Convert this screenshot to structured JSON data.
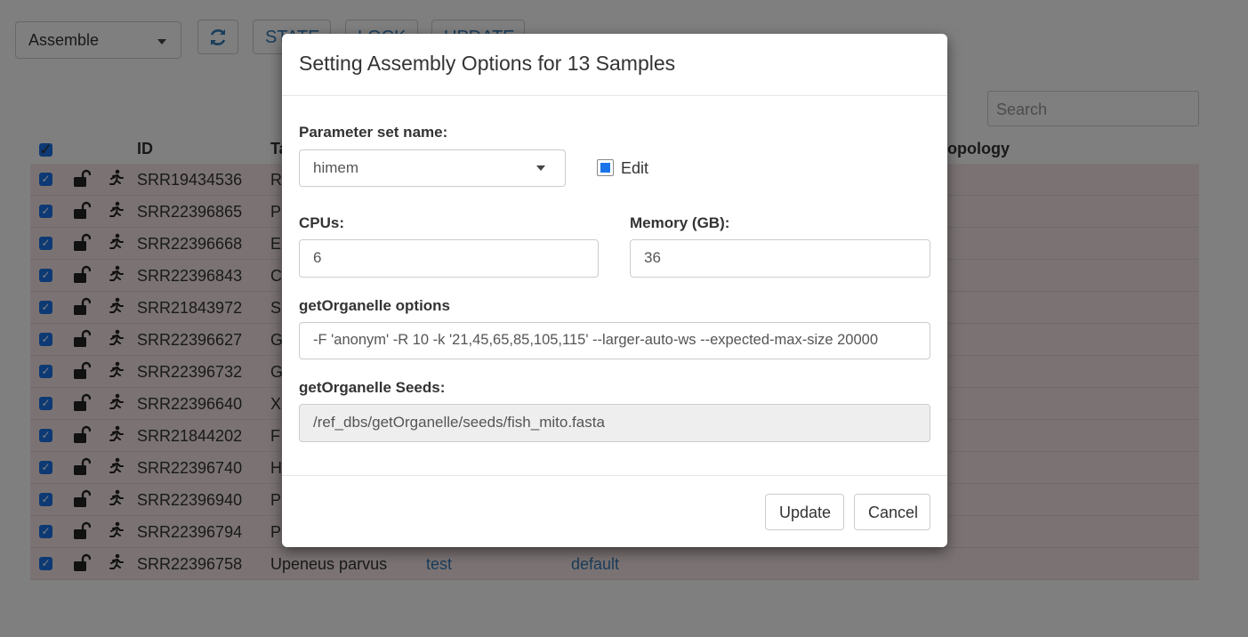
{
  "toolbar": {
    "mode_select": "Assemble",
    "refresh_icon": "refresh-icon",
    "state_label": "STATE",
    "lock_label": "LOCK",
    "update_label": "UPDATE",
    "search_placeholder": "Search"
  },
  "table": {
    "headers": {
      "id": "ID",
      "taxon": "Ta",
      "topology": "opology"
    },
    "rows": [
      {
        "id": "SRR19434536",
        "taxon": "R",
        "col3": "",
        "col4": ""
      },
      {
        "id": "SRR22396865",
        "taxon": "P",
        "col3": "",
        "col4": ""
      },
      {
        "id": "SRR22396668",
        "taxon": "E",
        "col3": "",
        "col4": ""
      },
      {
        "id": "SRR22396843",
        "taxon": "C",
        "col3": "",
        "col4": ""
      },
      {
        "id": "SRR21843972",
        "taxon": "S",
        "col3": "",
        "col4": ""
      },
      {
        "id": "SRR22396627",
        "taxon": "G",
        "col3": "",
        "col4": ""
      },
      {
        "id": "SRR22396732",
        "taxon": "G",
        "col3": "",
        "col4": ""
      },
      {
        "id": "SRR22396640",
        "taxon": "X",
        "col3": "",
        "col4": ""
      },
      {
        "id": "SRR21844202",
        "taxon": "F",
        "col3": "",
        "col4": ""
      },
      {
        "id": "SRR22396740",
        "taxon": "H",
        "col3": "",
        "col4": ""
      },
      {
        "id": "SRR22396940",
        "taxon": "P",
        "col3": "",
        "col4": ""
      },
      {
        "id": "SRR22396794",
        "taxon": "P",
        "col3": "",
        "col4": ""
      },
      {
        "id": "SRR22396758",
        "taxon": "Upeneus parvus",
        "col3": "test",
        "col4": "default"
      }
    ]
  },
  "modal": {
    "title": "Setting Assembly Options for 13 Samples",
    "param_set_label": "Parameter set name:",
    "param_set_value": "himem",
    "edit_label": "Edit",
    "edit_checked": true,
    "cpus_label": "CPUs:",
    "cpus_value": "6",
    "memory_label": "Memory (GB):",
    "memory_value": "36",
    "options_label": "getOrganelle options",
    "options_value": "-F 'anonym' -R 10 -k '21,45,65,85,105,115' --larger-auto-ws --expected-max-size 20000",
    "seeds_label": "getOrganelle Seeds:",
    "seeds_value": "/ref_dbs/getOrganelle/seeds/fish_mito.fasta",
    "update_button": "Update",
    "cancel_button": "Cancel"
  },
  "colors": {
    "accent": "#1a73e8",
    "link": "#337ab7",
    "row_background": "#f7e6e6",
    "backdrop": "rgba(0,0,0,0.5)"
  }
}
